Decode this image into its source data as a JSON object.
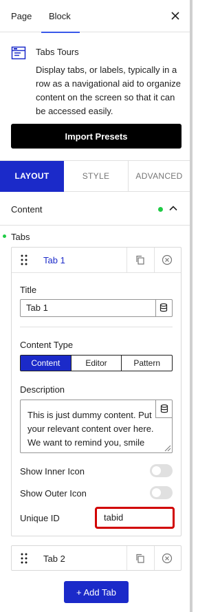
{
  "header": {
    "tabs": [
      {
        "label": "Page"
      },
      {
        "label": "Block"
      }
    ]
  },
  "block": {
    "title": "Tabs Tours",
    "description": "Display tabs, or labels, typically in a row as a navigational aid to organize content on the screen so that it can be accessed easily."
  },
  "import_presets_label": "Import Presets",
  "panel_tabs": [
    {
      "label": "LAYOUT"
    },
    {
      "label": "STYLE"
    },
    {
      "label": "ADVANCED"
    }
  ],
  "content_section": {
    "title": "Content"
  },
  "tabs_label": "Tabs",
  "items": [
    {
      "name": "Tab 1",
      "title_label": "Title",
      "title_value": "Tab 1",
      "content_type_label": "Content Type",
      "content_type_options": [
        {
          "label": "Content"
        },
        {
          "label": "Editor"
        },
        {
          "label": "Pattern"
        }
      ],
      "content_type_selected": "Content",
      "description_label": "Description",
      "description_value": "This is just dummy content. Put your relevant content over here. We want to remind you, smile and passion are contagious, be a",
      "show_inner_icon_label": "Show Inner Icon",
      "show_outer_icon_label": "Show Outer Icon",
      "unique_id_label": "Unique ID",
      "unique_id_value": "tabid"
    },
    {
      "name": "Tab 2"
    }
  ],
  "add_tab_label": "+ Add Tab",
  "colors": {
    "accent": "#1b2ac9",
    "indicator": "#1fcb45",
    "highlight": "#d10000"
  }
}
